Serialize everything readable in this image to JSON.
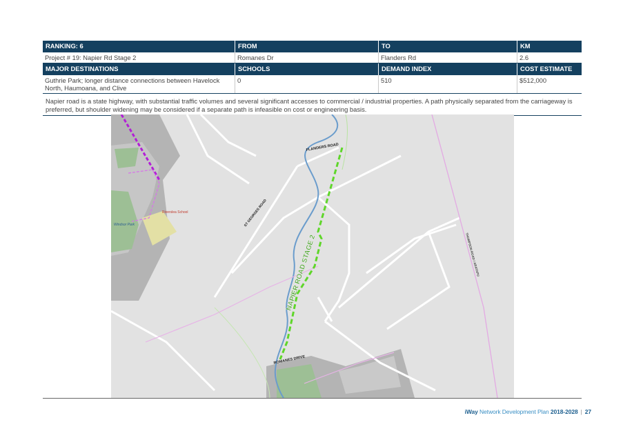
{
  "table": {
    "row1_headers": [
      "RANKING: 6",
      "FROM",
      "TO",
      "KM"
    ],
    "row1_values": [
      "Project # 19: Napier Rd Stage 2",
      "Romanes Dr",
      "Flanders Rd",
      "2.6"
    ],
    "row2_headers": [
      "MAJOR DESTINATIONS",
      "SCHOOLS",
      "DEMAND INDEX",
      "COST ESTIMATE"
    ],
    "row2_values": [
      "Guthrie Park; longer distance connections between Havelock North, Haumoana, and Clive",
      "0",
      "510",
      "$512,000"
    ]
  },
  "description": "Napier road is a state highway, with substantial traffic volumes and several significant accesses to commercial / industrial properties. A path physically separated from the carriageway is preferred, but shoulder widening may be considered if a separate path is infeasible on cost or engineering basis.",
  "map": {
    "labels": {
      "flanders": "FLANDERS ROAD",
      "georges": "ST GEORGES ROAD",
      "napier": "NAPIER ROAD STAGE 2",
      "romanes": "ROMANES DRIVE",
      "thompson": "THOMPSON ROAD / ARATAPU",
      "riverslea": "Riverslea School",
      "windsor": "Windsor Park"
    },
    "colors": {
      "route": "#5fd62a",
      "boundary": "#b21fd6",
      "river": "#6a9ccc",
      "park": "#a9c6a0",
      "school": "#e3e0a5"
    }
  },
  "footer": {
    "brand_prefix": "iWay",
    "brand_suffix": " Network Development Plan",
    "years": " 2018-2028",
    "page_number": "27"
  }
}
